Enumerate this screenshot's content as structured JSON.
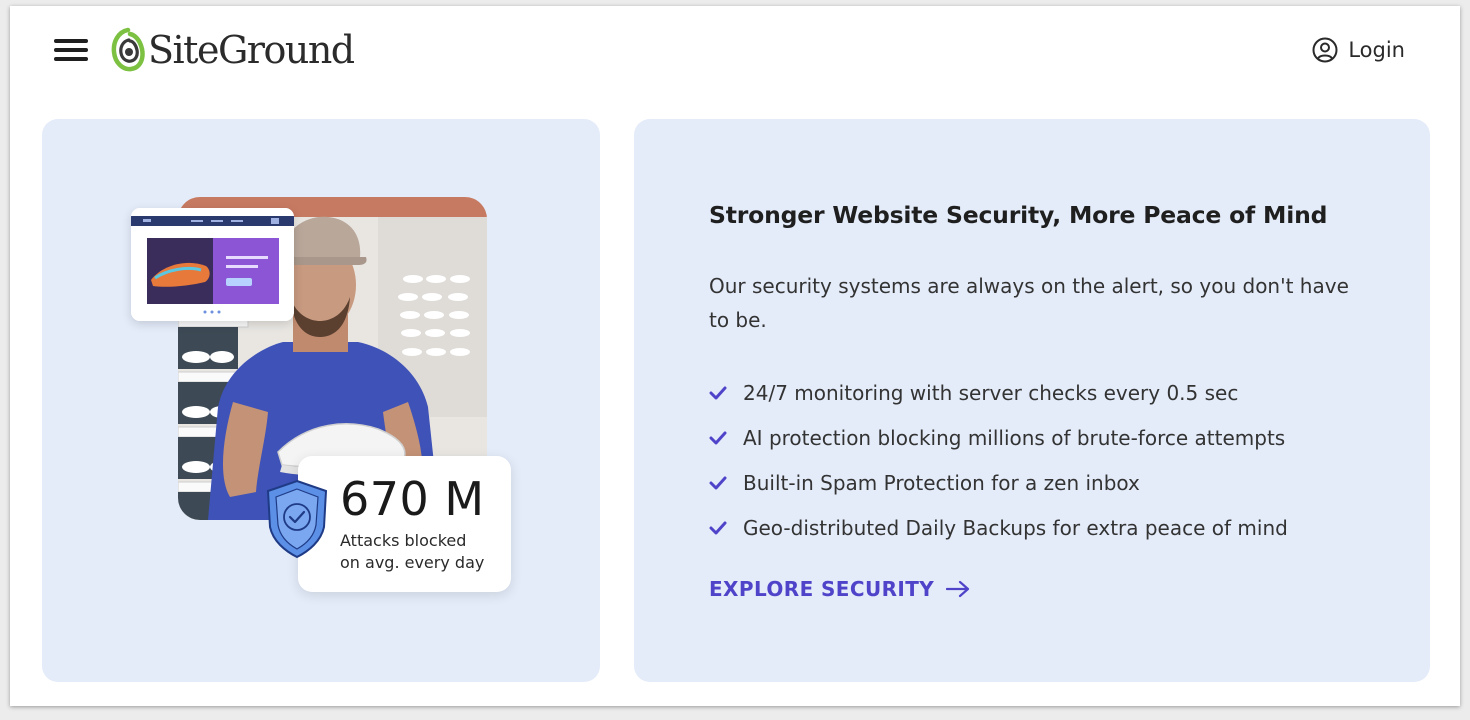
{
  "header": {
    "logo_text": "SiteGround",
    "login_label": "Login"
  },
  "promo": {
    "stat_value": "670 M",
    "stat_label_line1": "Attacks blocked",
    "stat_label_line2": "on avg. every day"
  },
  "security": {
    "title": "Stronger Website Security, More Peace of Mind",
    "intro": "Our security systems are always on the alert, so you don't have to be.",
    "features": [
      "24/7 monitoring with server checks every 0.5 sec",
      "AI protection blocking millions of brute-force attempts",
      "Built-in Spam Protection for a zen inbox",
      "Geo-distributed Daily Backups for extra peace of mind"
    ],
    "cta_label": "EXPLORE SECURITY"
  },
  "colors": {
    "card_bg": "#e4ecfa",
    "accent": "#4f44c9",
    "logo_green": "#7cc142"
  },
  "icons": [
    "menu-icon",
    "siteground-logo-icon",
    "user-circle-icon",
    "shield-check-icon",
    "checkmark-icon",
    "arrow-right-icon"
  ]
}
